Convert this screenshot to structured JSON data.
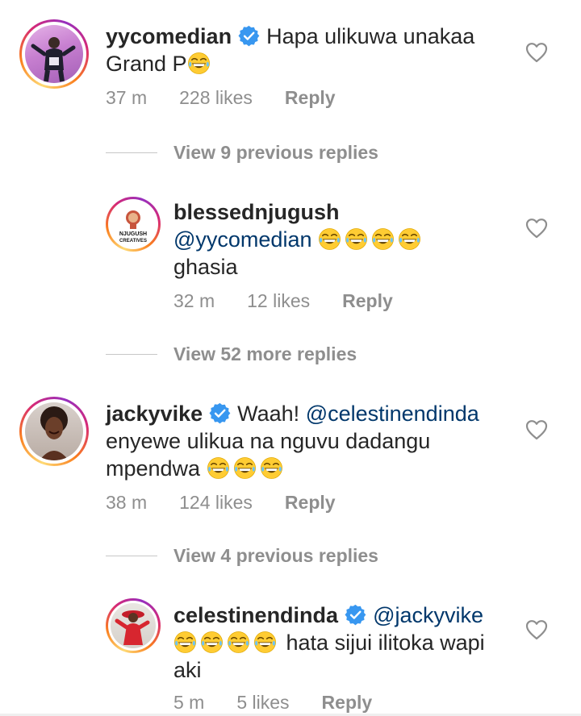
{
  "comments": [
    {
      "username": "yycomedian",
      "text_parts": [
        "Hapa ulikuwa unakaa",
        "Grand P"
      ],
      "time": "37 m",
      "likes": "228 likes",
      "reply_label": "Reply",
      "verified": true
    },
    {
      "username": "blessednjugush",
      "mention": "@yycomedian",
      "text_after": "ghasia",
      "time": "32 m",
      "likes": "12 likes",
      "reply_label": "Reply",
      "avatar_text": [
        "NJUGUSH",
        "CREATIVES"
      ]
    },
    {
      "username": "jackyvike",
      "prefix": "Waah!",
      "mention": "@celestinendinda",
      "line2": "enyewe ulikua na nguvu dadangu",
      "line3": "mpendwa",
      "time": "38 m",
      "likes": "124 likes",
      "reply_label": "Reply",
      "verified": true
    },
    {
      "username": "celestinendinda",
      "mention": "@jackyvike",
      "line2": "hata sijui ilitoka wapi",
      "line3": "aki",
      "time": "5 m",
      "likes": "5 likes",
      "reply_label": "Reply",
      "verified": true
    }
  ],
  "view_replies": [
    "View 9 previous replies",
    "View 52 more replies",
    "View 4 previous replies"
  ],
  "icons": {
    "heart": "heart-outline-icon",
    "verified": "verified-badge-icon",
    "emoji": "tears-of-joy-emoji"
  },
  "colors": {
    "mention": "#00376b",
    "meta": "#8e8e8e",
    "verified": "#3897f0"
  }
}
